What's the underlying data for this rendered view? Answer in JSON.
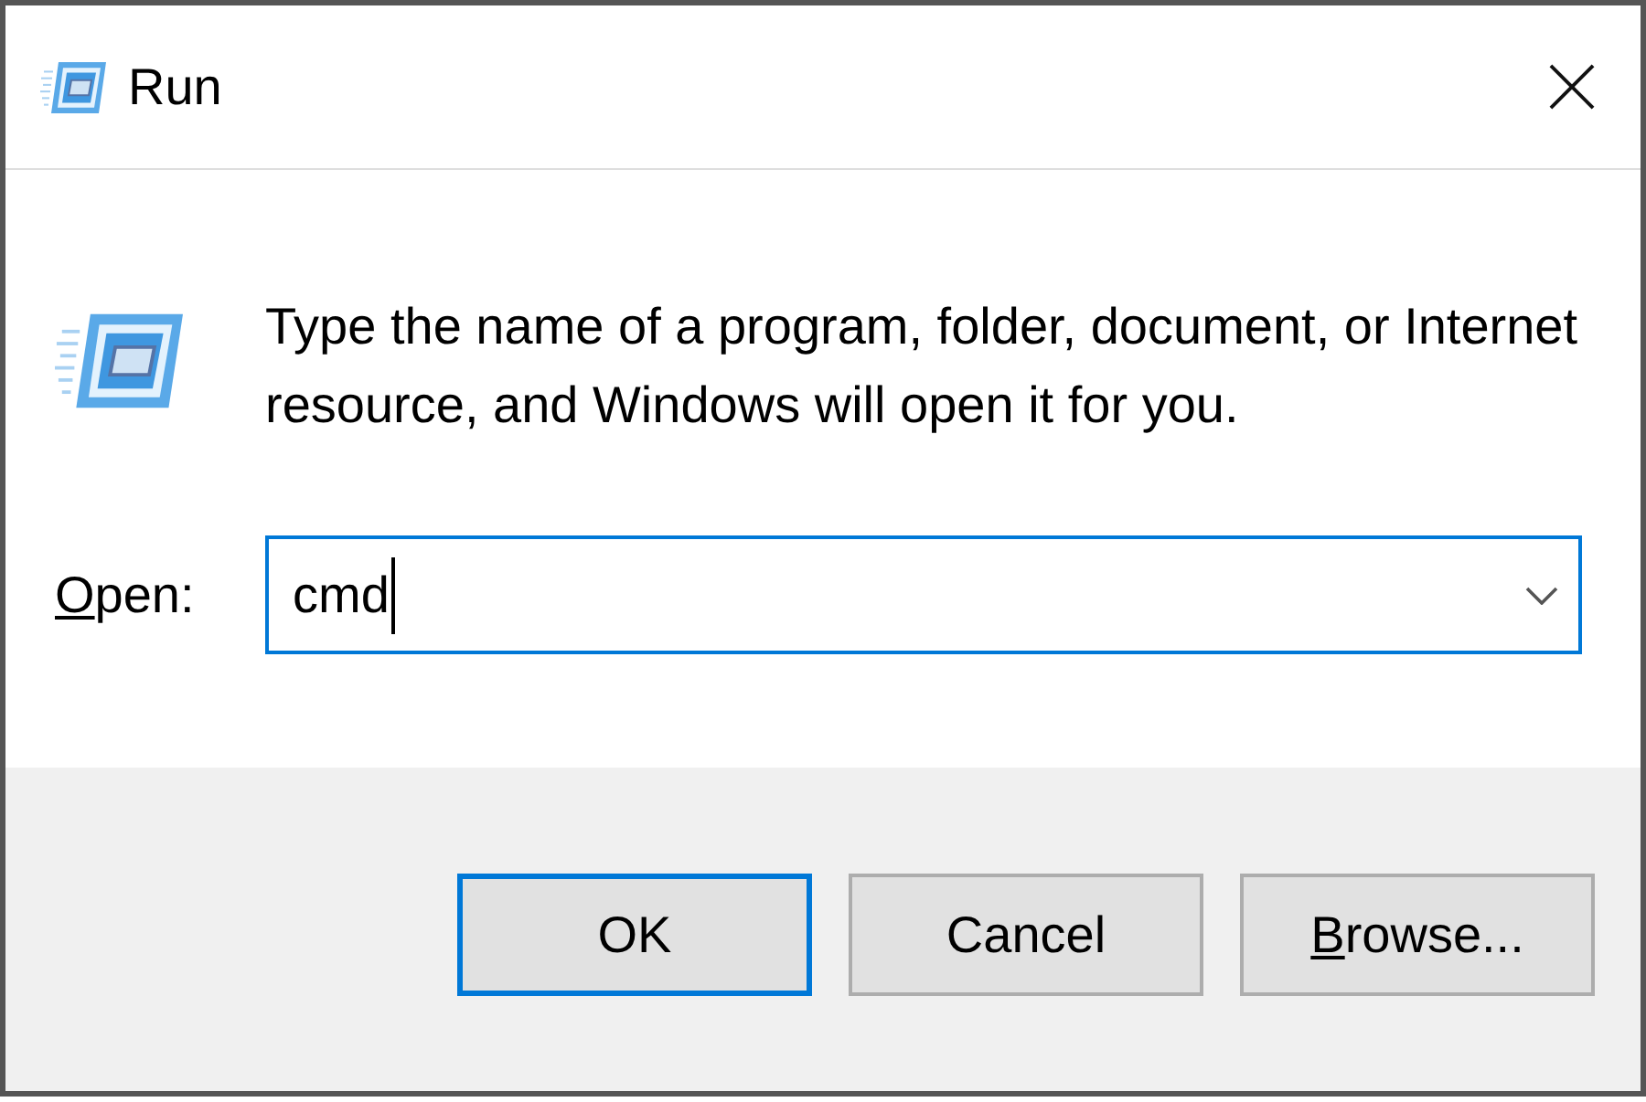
{
  "window": {
    "title": "Run"
  },
  "description": "Type the name of a program, folder, document, or Internet resource, and Windows will open it for you.",
  "open_field": {
    "label": "Open:",
    "first_letter_underlined": true,
    "value": "cmd",
    "focused": true
  },
  "buttons": [
    {
      "label": "OK",
      "default": true,
      "first_letter_underlined": false
    },
    {
      "label": "Cancel",
      "default": false,
      "first_letter_underlined": false
    },
    {
      "label": "Browse...",
      "default": false,
      "first_letter_underlined": true
    }
  ]
}
